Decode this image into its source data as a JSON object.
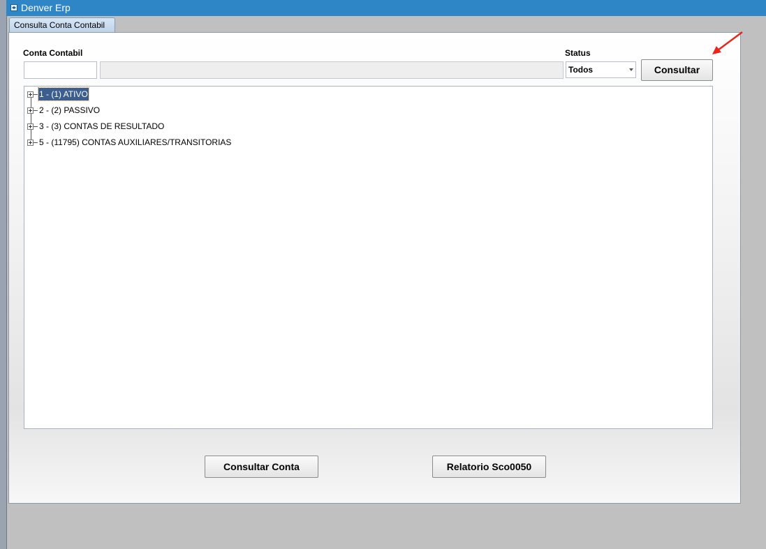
{
  "window": {
    "title": "Denver Erp",
    "icon": "app-window-icon"
  },
  "tab": {
    "label": "Consulta Conta Contabil"
  },
  "form": {
    "conta_label": "Conta Contabil",
    "conta_value": "",
    "conta_description": "",
    "status_label": "Status",
    "status_value": "Todos",
    "consultar_label": "Consultar"
  },
  "tree": {
    "nodes": [
      {
        "label": "1 - (1) ATIVO",
        "selected": true,
        "expandable": true
      },
      {
        "label": "2 - (2) PASSIVO",
        "selected": false,
        "expandable": true
      },
      {
        "label": "3 - (3) CONTAS DE RESULTADO",
        "selected": false,
        "expandable": true
      },
      {
        "label": "5 - (11795) CONTAS AUXILIARES/TRANSITORIAS",
        "selected": false,
        "expandable": true
      }
    ]
  },
  "footer": {
    "consultar_conta_label": "Consultar Conta",
    "relatorio_label": "Relatorio Sco0050"
  },
  "colors": {
    "titlebar": "#2f86c6",
    "selection": "#3b5e8f",
    "annotation_arrow": "#e8261c"
  }
}
